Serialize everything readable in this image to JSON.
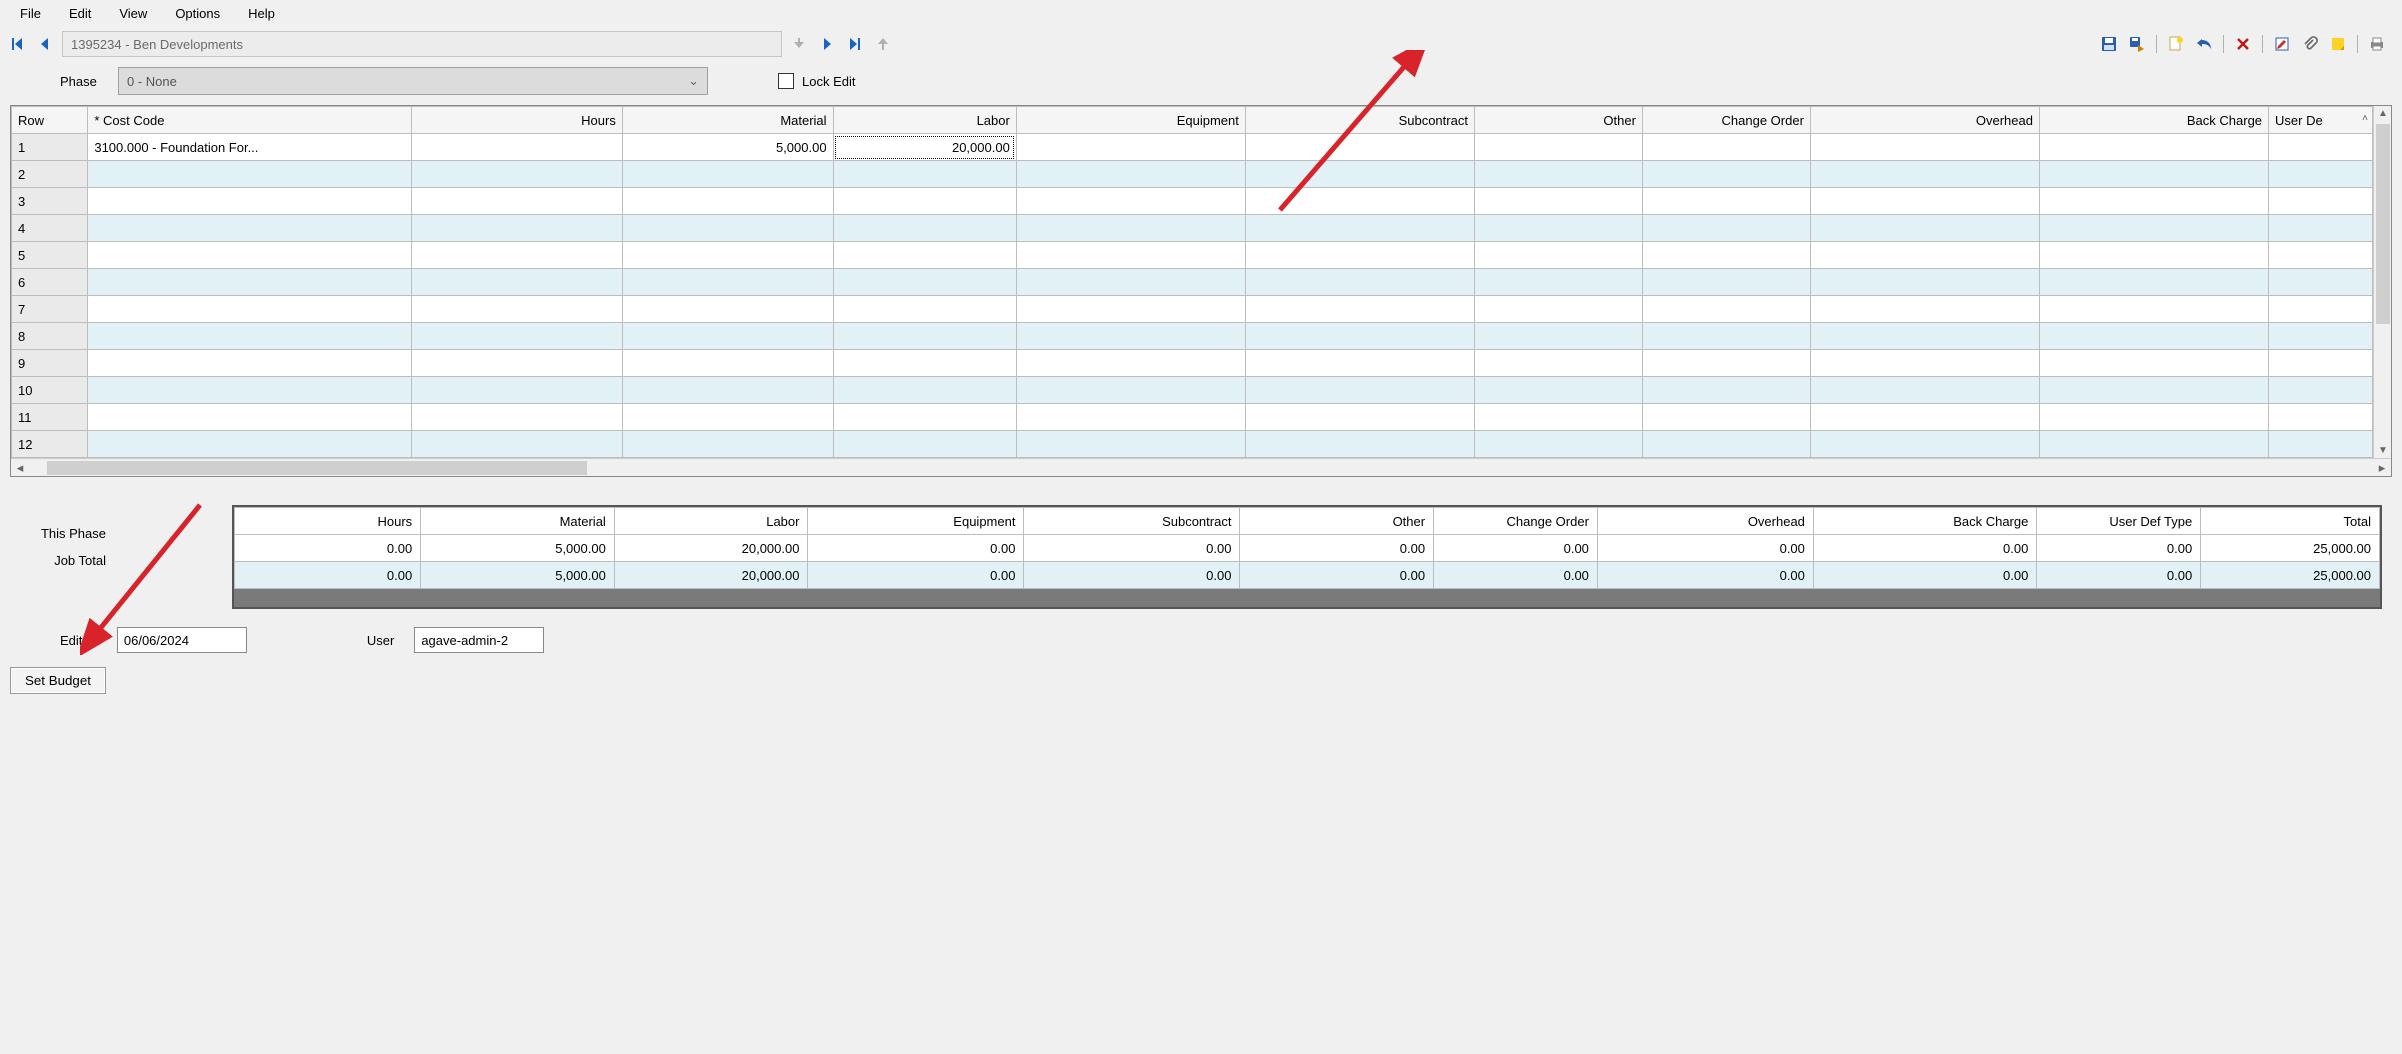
{
  "menu": {
    "file": "File",
    "edit": "Edit",
    "view": "View",
    "options": "Options",
    "help": "Help"
  },
  "nav": {
    "record": "1395234 - Ben Developments"
  },
  "phase": {
    "label": "Phase",
    "value": "0 - None",
    "lock_label": "Lock Edit"
  },
  "grid": {
    "headers": {
      "row": "Row",
      "cost_code": "* Cost Code",
      "hours": "Hours",
      "material": "Material",
      "labor": "Labor",
      "equipment": "Equipment",
      "subcontract": "Subcontract",
      "other": "Other",
      "change_order": "Change Order",
      "overhead": "Overhead",
      "back_charge": "Back Charge",
      "user_def": "User De"
    },
    "rows": [
      {
        "n": "1",
        "cost_code": "3100.000 - Foundation For...",
        "hours": "",
        "material": "5,000.00",
        "labor": "20,000.00",
        "equipment": "",
        "subcontract": "",
        "other": "",
        "change_order": "",
        "overhead": "",
        "back_charge": "",
        "user_def": ""
      },
      {
        "n": "2"
      },
      {
        "n": "3"
      },
      {
        "n": "4"
      },
      {
        "n": "5"
      },
      {
        "n": "6"
      },
      {
        "n": "7"
      },
      {
        "n": "8"
      },
      {
        "n": "9"
      },
      {
        "n": "10"
      },
      {
        "n": "11"
      },
      {
        "n": "12"
      }
    ]
  },
  "summary": {
    "headers": {
      "hours": "Hours",
      "material": "Material",
      "labor": "Labor",
      "equipment": "Equipment",
      "subcontract": "Subcontract",
      "other": "Other",
      "change_order": "Change Order",
      "overhead": "Overhead",
      "back_charge": "Back Charge",
      "user_def_type": "User Def Type",
      "total": "Total"
    },
    "rows": {
      "this_phase": {
        "label": "This Phase",
        "hours": "0.00",
        "material": "5,000.00",
        "labor": "20,000.00",
        "equipment": "0.00",
        "subcontract": "0.00",
        "other": "0.00",
        "change_order": "0.00",
        "overhead": "0.00",
        "back_charge": "0.00",
        "user_def_type": "0.00",
        "total": "25,000.00"
      },
      "job_total": {
        "label": "Job Total",
        "hours": "0.00",
        "material": "5,000.00",
        "labor": "20,000.00",
        "equipment": "0.00",
        "subcontract": "0.00",
        "other": "0.00",
        "change_order": "0.00",
        "overhead": "0.00",
        "back_charge": "0.00",
        "user_def_type": "0.00",
        "total": "25,000.00"
      }
    }
  },
  "footer": {
    "edited_label": "Edited",
    "edited_value": "06/06/2024",
    "user_label": "User",
    "user_value": "agave-admin-2",
    "set_budget": "Set Budget"
  },
  "icons": {
    "first": "first-record",
    "prev": "prev-record",
    "next": "next-record",
    "last": "last-record",
    "down": "down-arrow",
    "up_out": "popout",
    "save": "save",
    "save_exit": "save-exit",
    "new": "new",
    "undo": "undo",
    "delete": "delete",
    "edit_note": "edit-note",
    "attach": "attach",
    "note": "sticky-note",
    "print": "print"
  }
}
